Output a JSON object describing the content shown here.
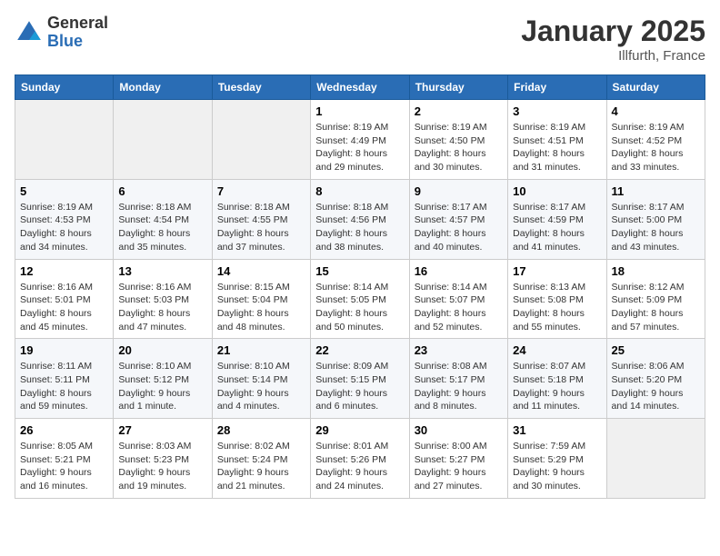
{
  "logo": {
    "general": "General",
    "blue": "Blue"
  },
  "title": "January 2025",
  "location": "Illfurth, France",
  "days_header": [
    "Sunday",
    "Monday",
    "Tuesday",
    "Wednesday",
    "Thursday",
    "Friday",
    "Saturday"
  ],
  "weeks": [
    [
      {
        "num": "",
        "info": ""
      },
      {
        "num": "",
        "info": ""
      },
      {
        "num": "",
        "info": ""
      },
      {
        "num": "1",
        "info": "Sunrise: 8:19 AM\nSunset: 4:49 PM\nDaylight: 8 hours\nand 29 minutes."
      },
      {
        "num": "2",
        "info": "Sunrise: 8:19 AM\nSunset: 4:50 PM\nDaylight: 8 hours\nand 30 minutes."
      },
      {
        "num": "3",
        "info": "Sunrise: 8:19 AM\nSunset: 4:51 PM\nDaylight: 8 hours\nand 31 minutes."
      },
      {
        "num": "4",
        "info": "Sunrise: 8:19 AM\nSunset: 4:52 PM\nDaylight: 8 hours\nand 33 minutes."
      }
    ],
    [
      {
        "num": "5",
        "info": "Sunrise: 8:19 AM\nSunset: 4:53 PM\nDaylight: 8 hours\nand 34 minutes."
      },
      {
        "num": "6",
        "info": "Sunrise: 8:18 AM\nSunset: 4:54 PM\nDaylight: 8 hours\nand 35 minutes."
      },
      {
        "num": "7",
        "info": "Sunrise: 8:18 AM\nSunset: 4:55 PM\nDaylight: 8 hours\nand 37 minutes."
      },
      {
        "num": "8",
        "info": "Sunrise: 8:18 AM\nSunset: 4:56 PM\nDaylight: 8 hours\nand 38 minutes."
      },
      {
        "num": "9",
        "info": "Sunrise: 8:17 AM\nSunset: 4:57 PM\nDaylight: 8 hours\nand 40 minutes."
      },
      {
        "num": "10",
        "info": "Sunrise: 8:17 AM\nSunset: 4:59 PM\nDaylight: 8 hours\nand 41 minutes."
      },
      {
        "num": "11",
        "info": "Sunrise: 8:17 AM\nSunset: 5:00 PM\nDaylight: 8 hours\nand 43 minutes."
      }
    ],
    [
      {
        "num": "12",
        "info": "Sunrise: 8:16 AM\nSunset: 5:01 PM\nDaylight: 8 hours\nand 45 minutes."
      },
      {
        "num": "13",
        "info": "Sunrise: 8:16 AM\nSunset: 5:03 PM\nDaylight: 8 hours\nand 47 minutes."
      },
      {
        "num": "14",
        "info": "Sunrise: 8:15 AM\nSunset: 5:04 PM\nDaylight: 8 hours\nand 48 minutes."
      },
      {
        "num": "15",
        "info": "Sunrise: 8:14 AM\nSunset: 5:05 PM\nDaylight: 8 hours\nand 50 minutes."
      },
      {
        "num": "16",
        "info": "Sunrise: 8:14 AM\nSunset: 5:07 PM\nDaylight: 8 hours\nand 52 minutes."
      },
      {
        "num": "17",
        "info": "Sunrise: 8:13 AM\nSunset: 5:08 PM\nDaylight: 8 hours\nand 55 minutes."
      },
      {
        "num": "18",
        "info": "Sunrise: 8:12 AM\nSunset: 5:09 PM\nDaylight: 8 hours\nand 57 minutes."
      }
    ],
    [
      {
        "num": "19",
        "info": "Sunrise: 8:11 AM\nSunset: 5:11 PM\nDaylight: 8 hours\nand 59 minutes."
      },
      {
        "num": "20",
        "info": "Sunrise: 8:10 AM\nSunset: 5:12 PM\nDaylight: 9 hours\nand 1 minute."
      },
      {
        "num": "21",
        "info": "Sunrise: 8:10 AM\nSunset: 5:14 PM\nDaylight: 9 hours\nand 4 minutes."
      },
      {
        "num": "22",
        "info": "Sunrise: 8:09 AM\nSunset: 5:15 PM\nDaylight: 9 hours\nand 6 minutes."
      },
      {
        "num": "23",
        "info": "Sunrise: 8:08 AM\nSunset: 5:17 PM\nDaylight: 9 hours\nand 8 minutes."
      },
      {
        "num": "24",
        "info": "Sunrise: 8:07 AM\nSunset: 5:18 PM\nDaylight: 9 hours\nand 11 minutes."
      },
      {
        "num": "25",
        "info": "Sunrise: 8:06 AM\nSunset: 5:20 PM\nDaylight: 9 hours\nand 14 minutes."
      }
    ],
    [
      {
        "num": "26",
        "info": "Sunrise: 8:05 AM\nSunset: 5:21 PM\nDaylight: 9 hours\nand 16 minutes."
      },
      {
        "num": "27",
        "info": "Sunrise: 8:03 AM\nSunset: 5:23 PM\nDaylight: 9 hours\nand 19 minutes."
      },
      {
        "num": "28",
        "info": "Sunrise: 8:02 AM\nSunset: 5:24 PM\nDaylight: 9 hours\nand 21 minutes."
      },
      {
        "num": "29",
        "info": "Sunrise: 8:01 AM\nSunset: 5:26 PM\nDaylight: 9 hours\nand 24 minutes."
      },
      {
        "num": "30",
        "info": "Sunrise: 8:00 AM\nSunset: 5:27 PM\nDaylight: 9 hours\nand 27 minutes."
      },
      {
        "num": "31",
        "info": "Sunrise: 7:59 AM\nSunset: 5:29 PM\nDaylight: 9 hours\nand 30 minutes."
      },
      {
        "num": "",
        "info": ""
      }
    ]
  ]
}
